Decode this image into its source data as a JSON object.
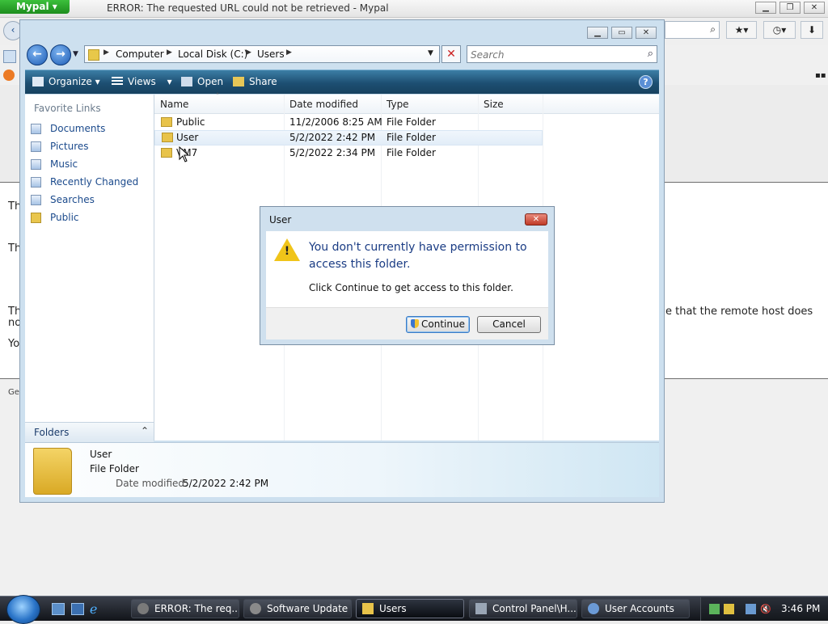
{
  "browser": {
    "app_button": "Mypal",
    "title": "ERROR: The requested URL could not be retrieved - Mypal",
    "bg_text_1": "Th",
    "bg_text_2": "Th",
    "bg_text_3": "Th",
    "bg_text_3b": "no",
    "bg_text_4": "Yo",
    "bg_text_right": "e that the remote host does",
    "bg_text_footer": "Ge"
  },
  "explorer": {
    "breadcrumb": [
      "Computer",
      "Local Disk (C:)",
      "Users"
    ],
    "search_placeholder": "Search",
    "commands": {
      "organize": "Organize",
      "views": "Views",
      "open": "Open",
      "share": "Share"
    },
    "nav": {
      "heading": "Favorite Links",
      "items": [
        {
          "label": "Documents",
          "icon": "documents-icon"
        },
        {
          "label": "Pictures",
          "icon": "pictures-icon"
        },
        {
          "label": "Music",
          "icon": "music-icon"
        },
        {
          "label": "Recently Changed",
          "icon": "recent-icon"
        },
        {
          "label": "Searches",
          "icon": "searches-icon"
        },
        {
          "label": "Public",
          "icon": "folder-icon"
        }
      ],
      "folders_label": "Folders"
    },
    "columns": [
      "Name",
      "Date modified",
      "Type",
      "Size"
    ],
    "rows": [
      {
        "name": "Public",
        "date": "11/2/2006 8:25 AM",
        "type": "File Folder",
        "size": ""
      },
      {
        "name": "User",
        "date": "5/2/2022 2:42 PM",
        "type": "File Folder",
        "size": ""
      },
      {
        "name": "VM7",
        "date": "5/2/2022 2:34 PM",
        "type": "File Folder",
        "size": ""
      }
    ],
    "details": {
      "name": "User",
      "type": "File Folder",
      "modified_label": "Date modified:",
      "modified_value": "5/2/2022 2:42 PM"
    }
  },
  "dialog": {
    "title": "User",
    "main_text": "You don't currently have permission to access this folder.",
    "sub_text": "Click Continue to get access to this folder.",
    "continue_label": "Continue",
    "cancel_label": "Cancel"
  },
  "taskbar": {
    "tasks": [
      {
        "label": "ERROR: The req..."
      },
      {
        "label": "Software Update"
      },
      {
        "label": "Users"
      },
      {
        "label": "Control Panel\\H..."
      },
      {
        "label": "User Accounts"
      }
    ],
    "clock": "3:46 PM"
  },
  "colors": {
    "accent": "#1a3c84",
    "command_bar": "#1d4f72",
    "warning": "#f0c419"
  }
}
